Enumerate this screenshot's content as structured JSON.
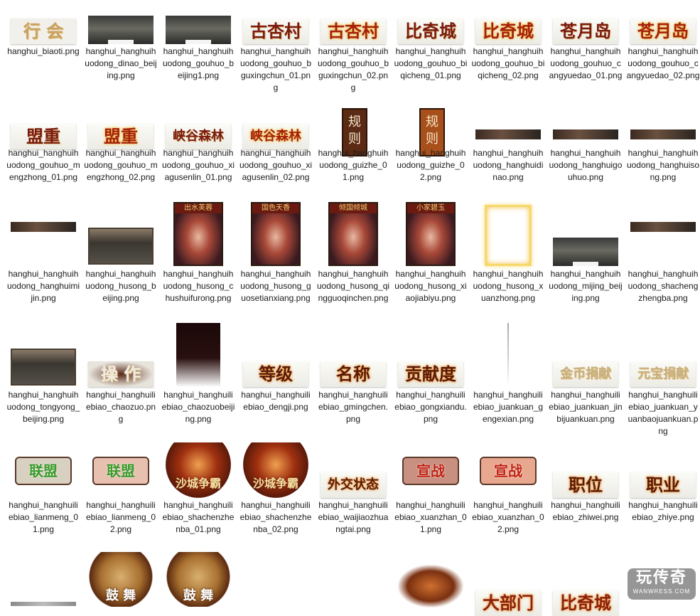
{
  "files": [
    {
      "name": "hanghui_biaoti.png",
      "preview": {
        "kind": "text",
        "text": "行 会",
        "color": "#c8a060",
        "bg": "#f2f0ea"
      }
    },
    {
      "name": "hanghui_hanghuihuodong_dinao_beijing.png",
      "preview": {
        "kind": "scene"
      }
    },
    {
      "name": "hanghui_hanghuihuodong_gouhuo_beijing1.png",
      "preview": {
        "kind": "scene"
      }
    },
    {
      "name": "hanghui_hanghuihuodong_gouhuo_bguxingchun_01.png",
      "preview": {
        "kind": "text",
        "text": "古杏村",
        "color": "#7a1a10"
      }
    },
    {
      "name": "hanghui_hanghuihuodong_gouhuo_bguxingchun_02.png",
      "preview": {
        "kind": "text",
        "text": "古杏村",
        "color": "#a42010",
        "glow": "#f5c040"
      }
    },
    {
      "name": "hanghui_hanghuihuodong_gouhuo_biqicheng_01.png",
      "preview": {
        "kind": "text",
        "text": "比奇城",
        "color": "#7a1a10"
      }
    },
    {
      "name": "hanghui_hanghuihuodong_gouhuo_biqicheng_02.png",
      "preview": {
        "kind": "text",
        "text": "比奇城",
        "color": "#a42010",
        "glow": "#f5c040"
      }
    },
    {
      "name": "hanghui_hanghuihuodong_gouhuo_cangyuedao_01.png",
      "preview": {
        "kind": "text",
        "text": "苍月岛",
        "color": "#7a1a10"
      }
    },
    {
      "name": "hanghui_hanghuihuodong_gouhuo_cangyuedao_02.png",
      "preview": {
        "kind": "text",
        "text": "苍月岛",
        "color": "#a42010",
        "glow": "#f5c040"
      }
    },
    {
      "name": "hanghui_hanghuihuodong_gouhuo_mengzhong_01.png",
      "preview": {
        "kind": "text",
        "text": "盟重",
        "color": "#7a1a10"
      }
    },
    {
      "name": "hanghui_hanghuihuodong_gouhuo_mengzhong_02.png",
      "preview": {
        "kind": "text",
        "text": "盟重",
        "color": "#a42010",
        "glow": "#f5c040"
      }
    },
    {
      "name": "hanghui_hanghuihuodong_gouhuo_xiagusenlin_01.png",
      "preview": {
        "kind": "text",
        "text": "峡谷森林",
        "color": "#7a1a10"
      }
    },
    {
      "name": "hanghui_hanghuihuodong_gouhuo_xiagusenlin_02.png",
      "preview": {
        "kind": "text",
        "text": "峡谷森林",
        "color": "#a42010",
        "glow": "#f5c040"
      }
    },
    {
      "name": "hanghui_hanghuihuodong_guizhe_01.png",
      "preview": {
        "kind": "vplaque",
        "text": "规则",
        "bg": "#5a2a14"
      }
    },
    {
      "name": "hanghui_hanghuihuodong_guizhe_02.png",
      "preview": {
        "kind": "vplaque",
        "text": "规则",
        "bg": "#a8501c"
      }
    },
    {
      "name": "hanghui_hanghuihuodong_hanghuidinao.png",
      "preview": {
        "kind": "strip"
      }
    },
    {
      "name": "hanghui_hanghuihuodong_hanghuigouhuo.png",
      "preview": {
        "kind": "strip"
      }
    },
    {
      "name": "hanghui_hanghuihuodong_hanghuisong.png",
      "preview": {
        "kind": "strip"
      }
    },
    {
      "name": "hanghui_hanghuihuodong_hanghuimijin.png",
      "preview": {
        "kind": "strip"
      }
    },
    {
      "name": "hanghui_hanghuihuodong_husong_beijing.png",
      "preview": {
        "kind": "frame"
      }
    },
    {
      "name": "hanghui_hanghuihuodong_husong_chushuifurong.png",
      "preview": {
        "kind": "portrait",
        "text": "出水芙蓉"
      }
    },
    {
      "name": "hanghui_hanghuihuodong_husong_guosetianxiang.png",
      "preview": {
        "kind": "portrait",
        "text": "国色天香"
      }
    },
    {
      "name": "hanghui_hanghuihuodong_husong_qingguoqinchen.png",
      "preview": {
        "kind": "portrait",
        "text": "倾国倾城"
      }
    },
    {
      "name": "hanghui_hanghuihuodong_husong_xiaojiabiyu.png",
      "preview": {
        "kind": "portrait",
        "text": "小家碧玉"
      }
    },
    {
      "name": "hanghui_hanghuihuodong_husong_xuanzhong.png",
      "preview": {
        "kind": "glowframe"
      }
    },
    {
      "name": "hanghui_hanghuihuodong_mijing_beijing.png",
      "preview": {
        "kind": "scene"
      }
    },
    {
      "name": "hanghui_hanghuihuodong_shachengzhengba.png",
      "preview": {
        "kind": "strip"
      }
    },
    {
      "name": "hanghui_hanghuihuodong_tongyong_beijing.png",
      "preview": {
        "kind": "frame"
      }
    },
    {
      "name": "hanghui_hanghuiliebiao_chaozuo.png",
      "preview": {
        "kind": "text",
        "text": "操 作",
        "color": "#f0ece0",
        "dark": true
      }
    },
    {
      "name": "hanghui_hanghuiliebiao_chaozuobeijing.png",
      "preview": {
        "kind": "gradient"
      }
    },
    {
      "name": "hanghui_hanghuiliebiao_dengji.png",
      "preview": {
        "kind": "text",
        "text": "等级",
        "color": "#5a1a0a",
        "glow": "#f0a040"
      }
    },
    {
      "name": "hanghui_hanghuiliebiao_gmingchen.png",
      "preview": {
        "kind": "text",
        "text": "名称",
        "color": "#5a1a0a",
        "glow": "#f0a040"
      }
    },
    {
      "name": "hanghui_hanghuiliebiao_gongxiandu.png",
      "preview": {
        "kind": "text",
        "text": "贡献度",
        "color": "#5a1a0a",
        "glow": "#f0a040"
      }
    },
    {
      "name": "hanghui_hanghuiliebiao_juankuan_gengexian.png",
      "preview": {
        "kind": "vline"
      }
    },
    {
      "name": "hanghui_hanghuiliebiao_juankuan_jinbijuankuan.png",
      "preview": {
        "kind": "text",
        "text": "金币捐献",
        "color": "#c8b080"
      }
    },
    {
      "name": "hanghui_hanghuiliebiao_juankuan_yuanbaojuankuan.png",
      "preview": {
        "kind": "text",
        "text": "元宝捐献",
        "color": "#c8b080"
      }
    },
    {
      "name": "hanghui_hanghuiliebiao_lianmeng_01.png",
      "preview": {
        "kind": "button",
        "text": "联盟",
        "color": "#3a9a2a",
        "bg": "#d8d0c0"
      }
    },
    {
      "name": "hanghui_hanghuiliebiao_lianmeng_02.png",
      "preview": {
        "kind": "button",
        "text": "联盟",
        "color": "#3a9a2a",
        "bg": "#e8c0b0"
      }
    },
    {
      "name": "hanghui_hanghuiliebiao_shachenzhenba_01.png",
      "preview": {
        "kind": "emblem",
        "text": "沙城争霸"
      }
    },
    {
      "name": "hanghui_hanghuiliebiao_shachenzhenba_02.png",
      "preview": {
        "kind": "emblem",
        "text": "沙城争霸"
      }
    },
    {
      "name": "hanghui_hanghuiliebiao_waijiaozhuangtai.png",
      "preview": {
        "kind": "text",
        "text": "外交状态",
        "color": "#5a1a0a",
        "glow": "#f0a040"
      }
    },
    {
      "name": "hanghui_hanghuiliebiao_xuanzhan_01.png",
      "preview": {
        "kind": "button",
        "text": "宣战",
        "color": "#c02010",
        "bg": "#c89080"
      }
    },
    {
      "name": "hanghui_hanghuiliebiao_xuanzhan_02.png",
      "preview": {
        "kind": "button",
        "text": "宣战",
        "color": "#c02010",
        "bg": "#e8a890"
      }
    },
    {
      "name": "hanghui_hanghuiliebiao_zhiwei.png",
      "preview": {
        "kind": "text",
        "text": "职位",
        "color": "#5a1a0a",
        "glow": "#f0a040"
      }
    },
    {
      "name": "hanghui_hanghuiliebiao_zhiye.png",
      "preview": {
        "kind": "text",
        "text": "职业",
        "color": "#5a1a0a",
        "glow": "#f0a040"
      }
    }
  ],
  "partial_row": [
    {
      "preview": {
        "kind": "thinbar"
      }
    },
    {
      "preview": {
        "kind": "drum",
        "text": "鼓 舞"
      }
    },
    {
      "preview": {
        "kind": "drum",
        "text": "鼓 舞"
      }
    },
    {
      "preview": {
        "kind": "empty"
      }
    },
    {
      "preview": {
        "kind": "empty"
      }
    },
    {
      "preview": {
        "kind": "lion"
      }
    },
    {
      "preview": {
        "kind": "text",
        "text": "大部门",
        "color": "#8a2010",
        "glow": "#f0a040"
      }
    },
    {
      "preview": {
        "kind": "text",
        "text": "比奇城",
        "color": "#8a2010",
        "glow": "#f0a040"
      }
    },
    {
      "preview": {
        "kind": "empty"
      }
    }
  ],
  "watermark": {
    "title": "玩传奇",
    "subtitle": "WANWRESS.COM"
  }
}
